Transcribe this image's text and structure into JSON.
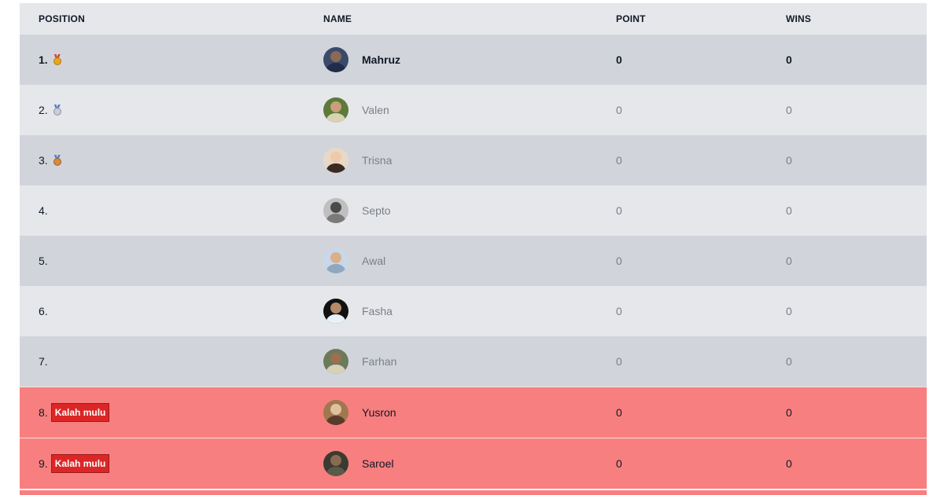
{
  "header": {
    "position": "POSITION",
    "name": "NAME",
    "point": "POINT",
    "wins": "WINS"
  },
  "rows": [
    {
      "position": "1.",
      "medal": "trophy-icon",
      "name": "Mahruz",
      "point": "0",
      "wins": "0"
    },
    {
      "position": "2.",
      "medal": "silver-medal-icon",
      "name": "Valen",
      "point": "0",
      "wins": "0"
    },
    {
      "position": "3.",
      "medal": "bronze-medal-icon",
      "name": "Trisna",
      "point": "0",
      "wins": "0"
    },
    {
      "position": "4.",
      "name": "Septo",
      "point": "0",
      "wins": "0"
    },
    {
      "position": "5.",
      "name": "Awal",
      "point": "0",
      "wins": "0"
    },
    {
      "position": "6.",
      "name": "Fasha",
      "point": "0",
      "wins": "0"
    },
    {
      "position": "7.",
      "name": "Farhan",
      "point": "0",
      "wins": "0"
    },
    {
      "position": "8.",
      "badge": "Kalah mulu",
      "name": "Yusron",
      "point": "0",
      "wins": "0"
    },
    {
      "position": "9.",
      "badge": "Kalah mulu",
      "name": "Saroel",
      "point": "0",
      "wins": "0"
    }
  ],
  "colors": {
    "row_dark": "#d1d5db",
    "row_light": "#e5e7eb",
    "loser_row": "#f87f7f",
    "badge": "#dc2626"
  }
}
